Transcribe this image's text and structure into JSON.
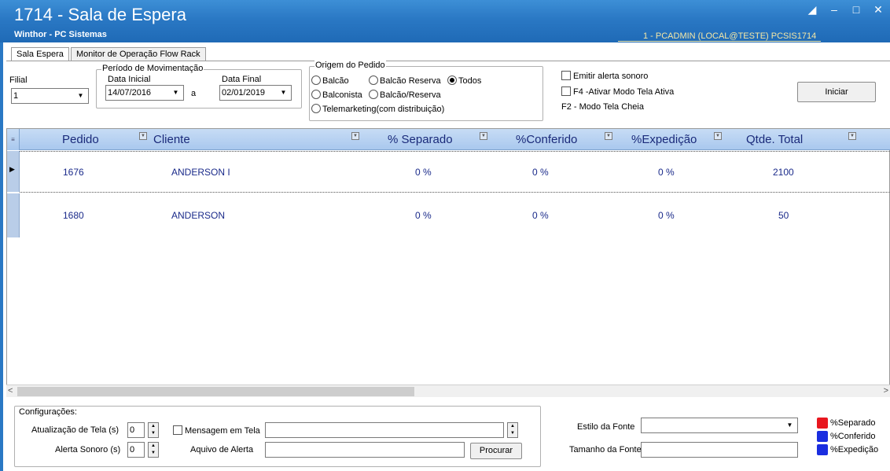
{
  "window": {
    "title": "1714 - Sala de Espera",
    "subtitle": "Winthor - PC Sistemas",
    "user_info": "1 - PCADMIN (LOCAL@TESTE)  PCSIS1714"
  },
  "tabs": [
    {
      "label": "Sala Espera",
      "active": true
    },
    {
      "label": "Monitor de Operação Flow Rack",
      "active": false
    }
  ],
  "filters": {
    "filial_label": "Filial",
    "filial_value": "1",
    "periodo_title": "Período de Movimentação",
    "data_inicial_label": "Data Inicial",
    "data_inicial_value": "14/07/2016",
    "a_label": "a",
    "data_final_label": "Data Final",
    "data_final_value": "02/01/2019",
    "origem_title": "Origem do Pedido",
    "origem_options": {
      "balcao": "Balcão",
      "balcao_reserva": "Balcão Reserva",
      "todos": "Todos",
      "balconista": "Balconista",
      "balcao_reserva2": "Balcão/Reserva",
      "telemarketing": "Telemarketing(com distribuição)"
    },
    "origem_selected": "Todos",
    "emitir_alerta": "Emitir alerta sonoro",
    "f4_label": "F4 -Ativar Modo Tela Ativa",
    "f2_label": "F2 - Modo Tela Cheia",
    "iniciar_label": "Iniciar"
  },
  "grid": {
    "columns": [
      "Pedido",
      "Cliente",
      "% Separado",
      "%Conferido",
      "%Expedição",
      "Qtde. Total"
    ],
    "rows": [
      {
        "pedido": "1676",
        "cliente": "ANDERSON I",
        "separado": "0 %",
        "conferido": "0 %",
        "expedicao": "0 %",
        "qtde": "2100"
      },
      {
        "pedido": "1680",
        "cliente": "ANDERSON",
        "separado": "0 %",
        "conferido": "0 %",
        "expedicao": "0 %",
        "qtde": "50"
      }
    ]
  },
  "config": {
    "title": "Configurações:",
    "atualizacao_label": "Atualização de Tela (s)",
    "atualizacao_value": "0",
    "alerta_label": "Alerta Sonoro (s)",
    "alerta_value": "0",
    "mensagem_label": "Mensagem em Tela",
    "arquivo_label": "Aquivo de Alerta",
    "procurar_label": "Procurar",
    "estilo_label": "Estilo da Fonte",
    "tamanho_label": "Tamanho da Fonte"
  },
  "legend": [
    {
      "label": "%Separado",
      "color": "#e8171f"
    },
    {
      "label": "%Conferido",
      "color": "#1a2ee0"
    },
    {
      "label": "%Expedição",
      "color": "#1a2ee0"
    }
  ],
  "colors": {
    "titlebar": "#2a78c4",
    "header_text": "#1a2a7a",
    "row_text": "#1a2a8a"
  }
}
